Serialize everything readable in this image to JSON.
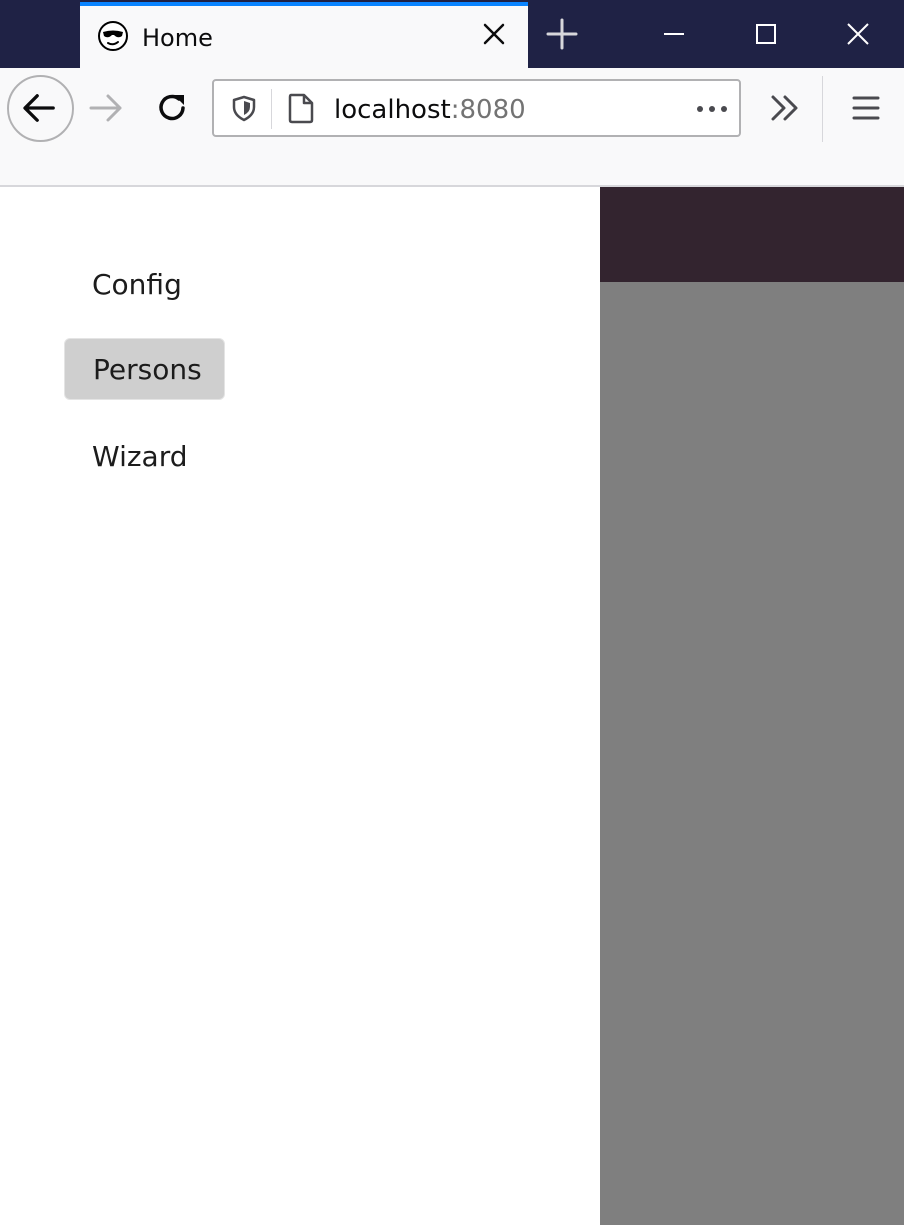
{
  "browser": {
    "tab": {
      "title": "Home",
      "favicon": "face-with-sunglasses-icon"
    },
    "new_tab_icon": "plus-icon",
    "window_controls": [
      "minimize-icon",
      "maximize-icon",
      "close-icon"
    ],
    "url": {
      "host": "localhost",
      "port": ":8080"
    },
    "colors": {
      "titlebar": "#1f2245",
      "tab_accent": "#0a84ff",
      "toolbar": "#f9f9fa"
    }
  },
  "sidebar": {
    "items": [
      {
        "label": "Config",
        "active": false
      },
      {
        "label": "Persons",
        "active": true
      },
      {
        "label": "Wizard",
        "active": false
      }
    ]
  },
  "main": {
    "colors": {
      "header": "#33242f",
      "overlay": "#7f7f7f"
    }
  }
}
